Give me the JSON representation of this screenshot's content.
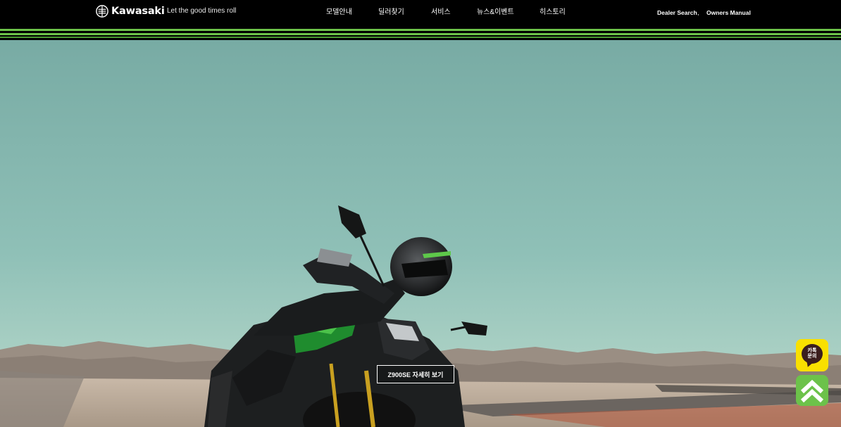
{
  "header": {
    "brand": "Kawasaki",
    "tagline": "Let the good times roll",
    "nav": [
      {
        "label": "모델안내"
      },
      {
        "label": "딜러찾기"
      },
      {
        "label": "서비스"
      },
      {
        "label": "뉴스&이벤트"
      },
      {
        "label": "히스토리"
      }
    ],
    "util_links": [
      {
        "label": "Dealer Search"
      },
      {
        "label": "Owners Manual"
      }
    ],
    "util_separator": ","
  },
  "hero": {
    "cta_label": "Z900SE 자세히 보기"
  },
  "floating": {
    "kakao_label": "카톡문의",
    "scroll_top_icon": "double-chevron-up-icon"
  },
  "colors": {
    "brand_green": "#6cc24a",
    "header_bg": "#000000",
    "kakao_yellow": "#f9e000"
  }
}
